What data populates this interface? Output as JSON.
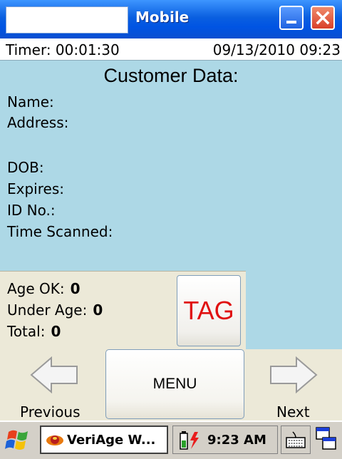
{
  "window": {
    "title": "Mobile"
  },
  "status": {
    "timer": "Timer: 00:01:30",
    "datetime": "09/13/2010 09:23"
  },
  "customer": {
    "heading": "Customer Data:",
    "fields": {
      "name": "Name:",
      "address": "Address:",
      "dob": "DOB:",
      "expires": "Expires:",
      "id_no": "ID No.:",
      "time_scanned": "Time Scanned:"
    }
  },
  "counters": {
    "age_ok_label": "Age OK:",
    "age_ok_value": "0",
    "under_age_label": "Under Age:",
    "under_age_value": "0",
    "total_label": "Total:",
    "total_value": "0"
  },
  "buttons": {
    "tag": "TAG",
    "menu": "MENU",
    "previous": "Previous",
    "next": "Next"
  },
  "taskbar": {
    "app_label": "VeriAge W...",
    "clock": "9:23 AM"
  },
  "colors": {
    "panel": "#add8e6",
    "tag_text": "#e01010",
    "titlebar": "#0054e3"
  },
  "icons": [
    "start-flag-icon",
    "veriage-app-icon",
    "battery-icon",
    "keyboard-icon",
    "window-switch-icon",
    "left-arrow-icon",
    "right-arrow-icon",
    "minimize-icon",
    "close-icon"
  ]
}
